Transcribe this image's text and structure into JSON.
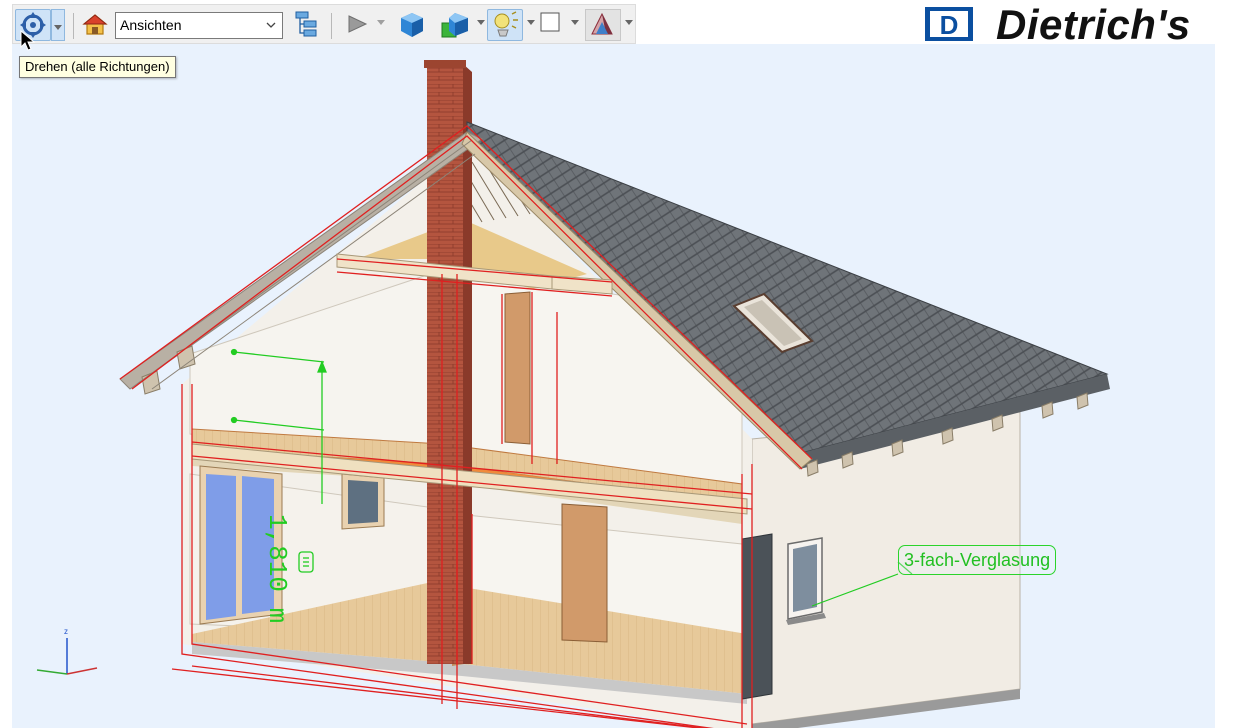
{
  "toolbar": {
    "rotate_tooltip": "Drehen (alle Richtungen)",
    "views_select": {
      "value": "Ansichten"
    }
  },
  "brand": {
    "name": "Dietrich's",
    "mark_letter": "D",
    "color": "#0b4fa0"
  },
  "viewport": {
    "background": "#e9f2fd",
    "dimension_label": "1,810 m",
    "callout_label": "3-fach-Verglasung",
    "axis_label_z": "z",
    "annotation_color": "#22cc22",
    "section_line_color": "#e02020"
  },
  "icons": [
    "rotate-icon",
    "home-icon",
    "model-tree-icon",
    "play-icon",
    "solid-cube-icon",
    "cube-color-icon",
    "light-icon",
    "frame-icon",
    "section-icon"
  ]
}
